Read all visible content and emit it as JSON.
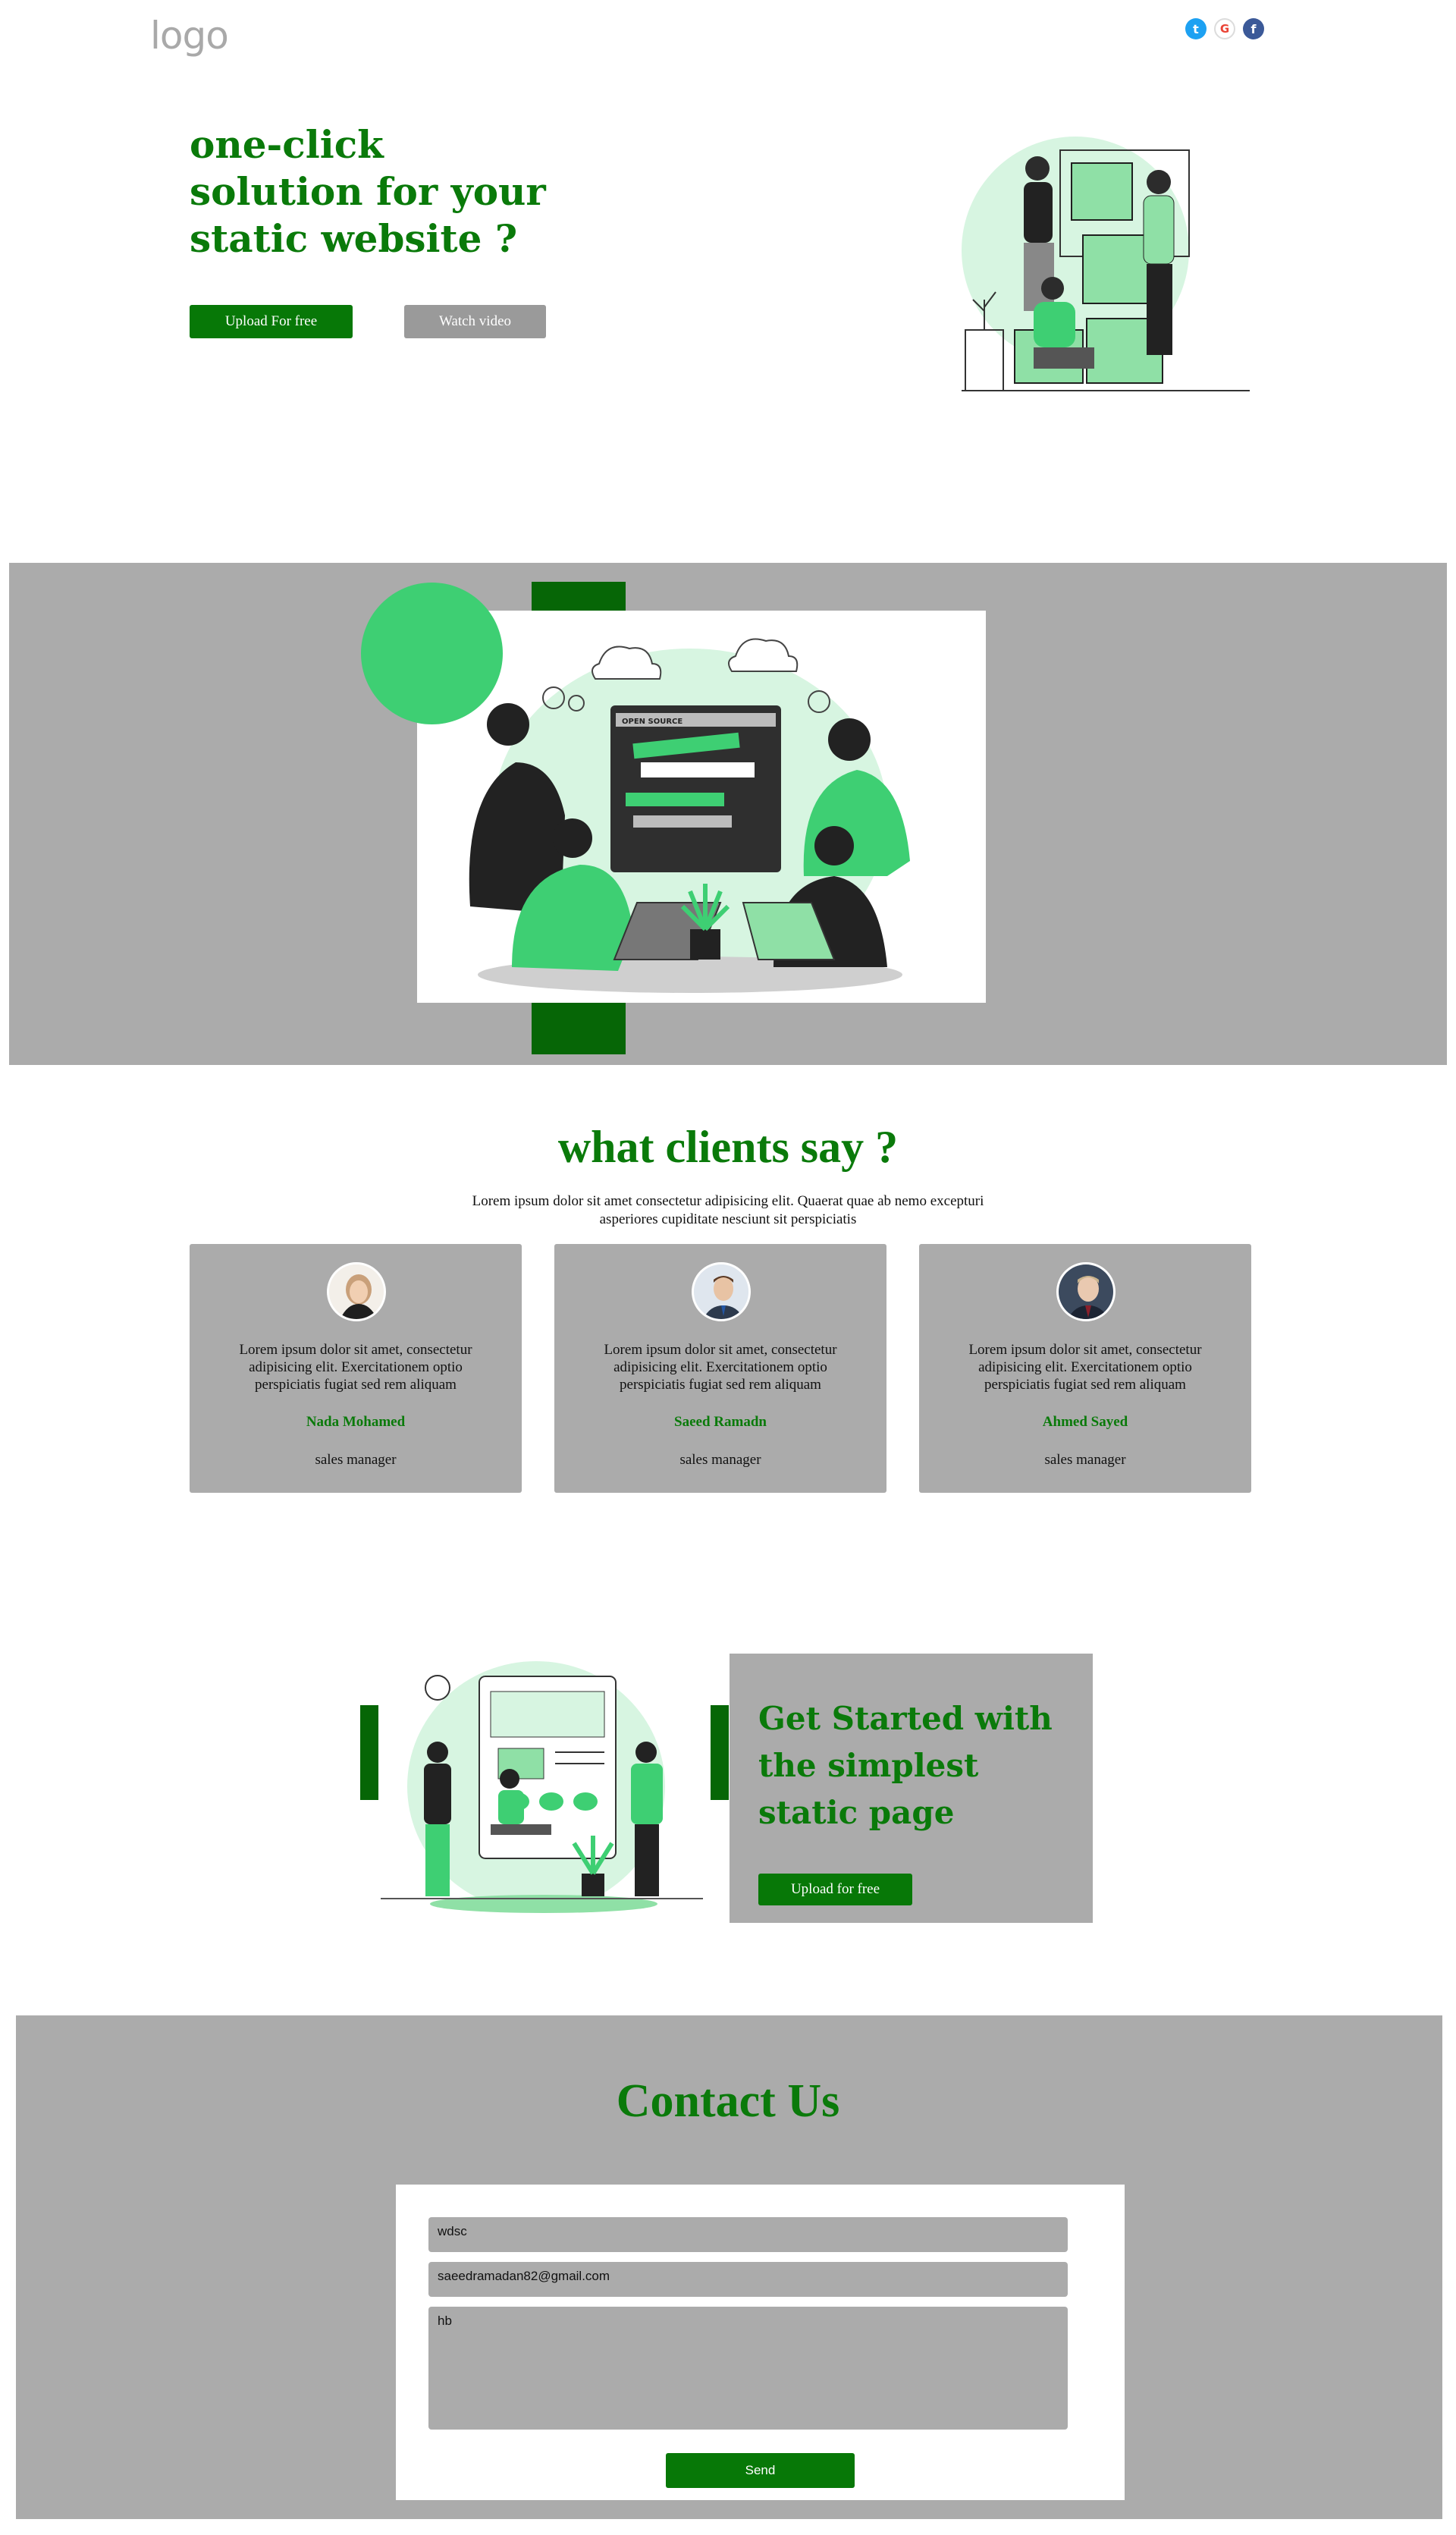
{
  "header": {
    "logo": "logo",
    "social": [
      {
        "icon": "twitter-icon",
        "glyph": "t",
        "color": "#1da1f2"
      },
      {
        "icon": "google-icon",
        "glyph": "G",
        "color": "#ea4335"
      },
      {
        "icon": "facebook-icon",
        "glyph": "f",
        "color": "#3b5998"
      }
    ]
  },
  "hero": {
    "title_line1": "one-click",
    "title_line2": "solution for your",
    "title_line3": "static website ?",
    "upload_label": "Upload For free",
    "watch_label": "Watch video"
  },
  "testimonials": {
    "title": "what clients say ?",
    "subtitle": "Lorem ipsum dolor sit amet consectetur adipisicing elit. Quaerat quae ab nemo excepturi asperiores cupiditate nesciunt sit perspiciatis",
    "cards": [
      {
        "text": "Lorem ipsum dolor sit amet, consectetur adipisicing elit. Exercitationem optio perspiciatis fugiat sed rem aliquam",
        "name": "Nada Mohamed",
        "role": "sales manager"
      },
      {
        "text": "Lorem ipsum dolor sit amet, consectetur adipisicing elit. Exercitationem optio perspiciatis fugiat sed rem aliquam",
        "name": "Saeed Ramadn",
        "role": "sales manager"
      },
      {
        "text": "Lorem ipsum dolor sit amet, consectetur adipisicing elit. Exercitationem optio perspiciatis fugiat sed rem aliquam",
        "name": "Ahmed Sayed",
        "role": "sales manager"
      }
    ]
  },
  "get_started": {
    "title_line1": "Get Started with",
    "title_line2": "the simplest",
    "title_line3": "static page",
    "button_label": "Upload for free"
  },
  "contact": {
    "title": "Contact Us",
    "name_value": "wdsc",
    "email_value": "saeedramadan82@gmail.com",
    "message_value": "hb",
    "send_label": "Send"
  },
  "colors": {
    "brand_green": "#0a7a0a",
    "gray_panel": "#ababab",
    "accent_light_green": "#3ecf73"
  }
}
